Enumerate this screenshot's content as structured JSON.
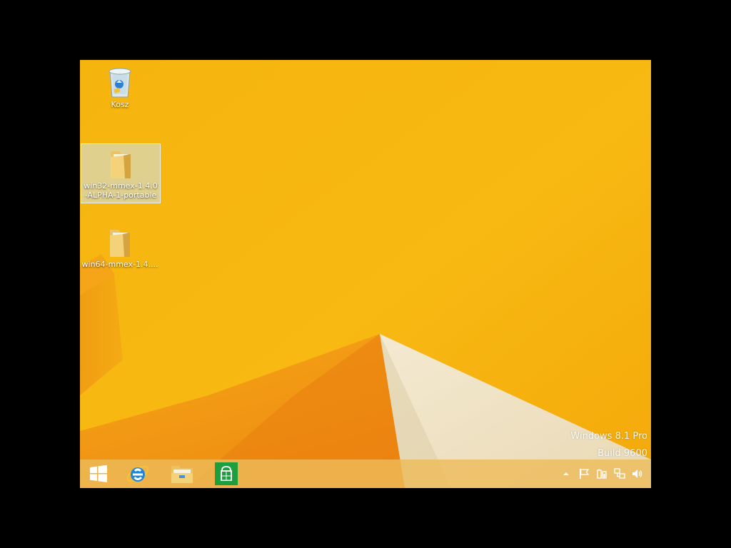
{
  "desktop": {
    "icons": [
      {
        "label": "Kosz",
        "icon": "recycle-bin-icon"
      },
      {
        "label": "win32-mmex-1.4.0-ALPHA-1-portable",
        "icon": "folder-icon",
        "selected": true
      },
      {
        "label": "win64-mmex-1.4....",
        "icon": "folder-icon"
      }
    ],
    "watermark": {
      "line1": "Windows 8.1 Pro",
      "line2": "Build 9600"
    }
  },
  "taskbar": {
    "buttons": [
      {
        "icon": "windows-start-icon"
      },
      {
        "icon": "internet-explorer-icon"
      },
      {
        "icon": "file-explorer-icon"
      },
      {
        "icon": "store-icon"
      }
    ],
    "tray": [
      {
        "icon": "show-hidden-icons-chevron-icon"
      },
      {
        "icon": "action-center-flag-icon"
      },
      {
        "icon": "power-icon"
      },
      {
        "icon": "network-icon"
      },
      {
        "icon": "volume-icon"
      }
    ]
  },
  "colors": {
    "wallpaper_base": "#f7b20a",
    "wallpaper_orange": "#ef8a10",
    "wallpaper_cream": "#efe2c4",
    "store_green": "#1e9e3c",
    "ie_blue": "#1e88d8"
  }
}
